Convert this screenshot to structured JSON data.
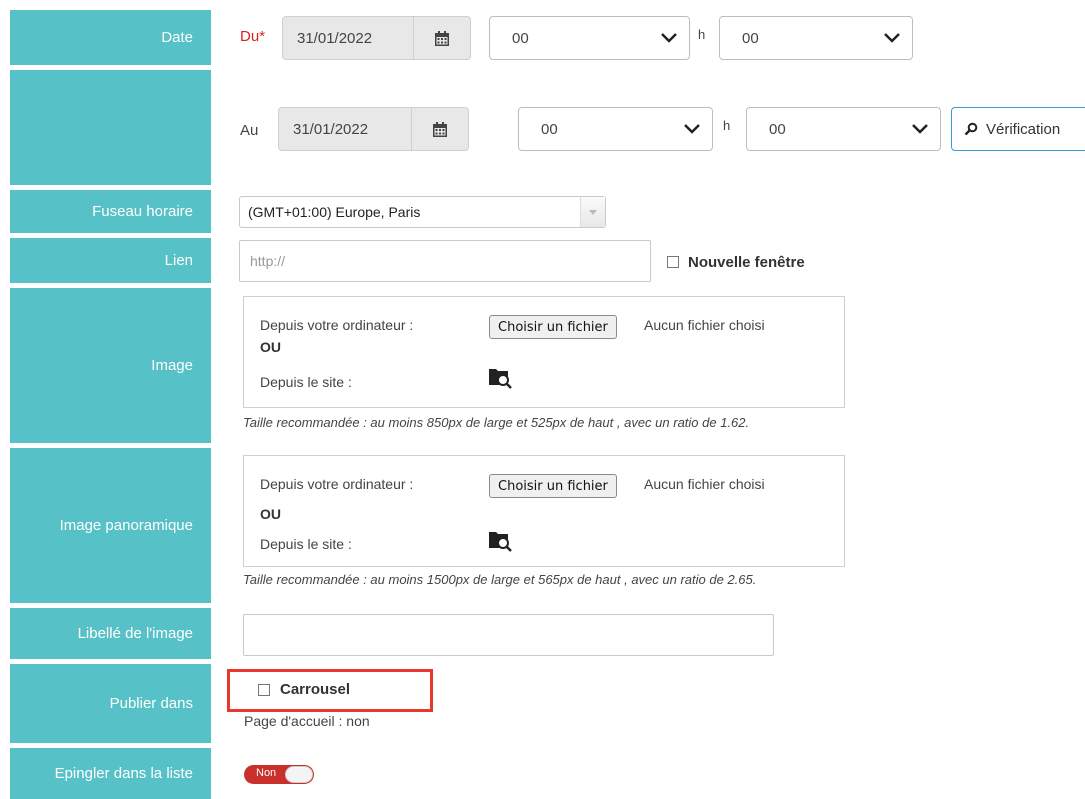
{
  "labels": {
    "date": "Date",
    "fuseau": "Fuseau horaire",
    "lien": "Lien",
    "image": "Image",
    "image_pano": "Image panoramique",
    "libelle": "Libellé de l'image",
    "publier": "Publier dans",
    "epingler": "Epingler dans la liste"
  },
  "date_from": {
    "prefix": "Du",
    "required_mark": "*",
    "date": "31/01/2022",
    "hour": "00",
    "h_sep": "h",
    "minute": "00"
  },
  "date_to": {
    "prefix": "Au",
    "date": "31/01/2022",
    "hour": "00",
    "h_sep": "h",
    "minute": "00",
    "verify_label": "Vérification"
  },
  "timezone": {
    "value": "(GMT+01:00) Europe, Paris"
  },
  "link": {
    "placeholder": "http://",
    "new_window_label": "Nouvelle fenêtre",
    "new_window_checked": false
  },
  "image": {
    "from_computer": "Depuis votre ordinateur :",
    "choose_button": "Choisir un fichier",
    "no_file": "Aucun fichier choisi",
    "or": "OU",
    "from_site": "Depuis le site :",
    "hint": "Taille recommandée : au moins 850px de large et 525px de haut , avec un ratio de 1.62."
  },
  "image_pano": {
    "from_computer": "Depuis votre ordinateur :",
    "choose_button": "Choisir un fichier",
    "no_file": "Aucun fichier choisi",
    "or": "OU",
    "from_site": "Depuis le site :",
    "hint": "Taille recommandée : au moins 1500px de large et 565px de haut , avec un ratio de 2.65."
  },
  "libelle": {
    "value": ""
  },
  "publish": {
    "carrousel_label": "Carrousel",
    "carrousel_checked": false,
    "homepage_text": "Page d'accueil : non"
  },
  "pin": {
    "toggle_label": "Non",
    "on": false
  },
  "colors": {
    "label_bg": "#56c1c6",
    "required": "#e02020",
    "highlight": "#e8372c",
    "toggle": "#c9302c"
  }
}
